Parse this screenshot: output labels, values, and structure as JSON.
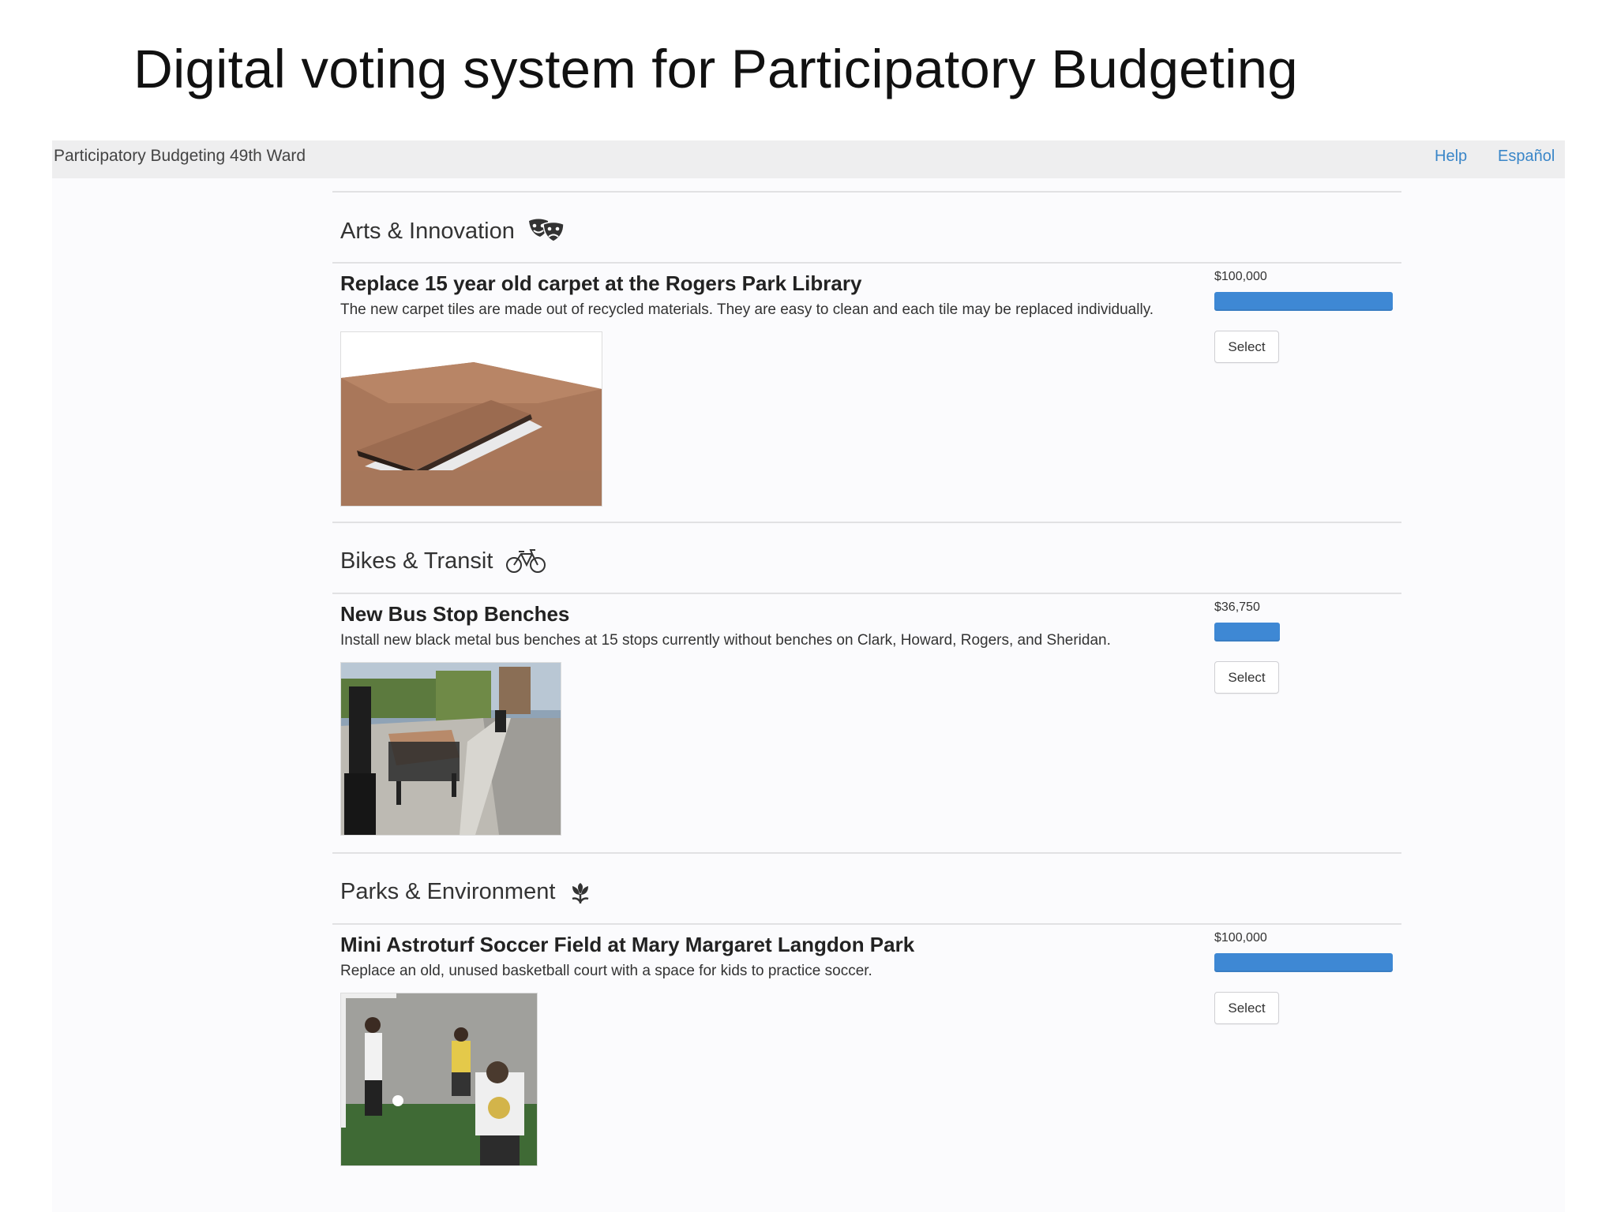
{
  "slide": {
    "title": "Digital voting system for Participatory Budgeting"
  },
  "header": {
    "brand": "Participatory Budgeting 49th Ward",
    "links": {
      "help": "Help",
      "language": "Español"
    }
  },
  "colors": {
    "accent": "#3e88d4",
    "link": "#3a86c8",
    "topbar": "#eeeeef"
  },
  "sections": [
    {
      "title": "Arts & Innovation",
      "icon": "theater-masks-icon",
      "project": {
        "title": "Replace 15 year old carpet at the Rogers Park Library",
        "description": "The new carpet tiles are made out of recycled materials. They are easy to clean and each tile may be replaced individually.",
        "cost": "$100,000",
        "cost_fraction": 1.0,
        "button": "Select",
        "image": "carpet-tiles-photo"
      }
    },
    {
      "title": "Bikes & Transit",
      "icon": "bicycle-icon",
      "project": {
        "title": "New Bus Stop Benches",
        "description": "Install new black metal bus benches at 15 stops currently without benches on Clark, Howard, Rogers, and Sheridan.",
        "cost": "$36,750",
        "cost_fraction": 0.3675,
        "button": "Select",
        "image": "bus-bench-photo"
      }
    },
    {
      "title": "Parks & Environment",
      "icon": "tulip-icon",
      "project": {
        "title": "Mini Astroturf Soccer Field at Mary Margaret Langdon Park",
        "description": "Replace an old, unused basketball court with a space for kids to practice soccer.",
        "cost": "$100,000",
        "cost_fraction": 1.0,
        "button": "Select",
        "image": "soccer-field-photo"
      }
    }
  ]
}
